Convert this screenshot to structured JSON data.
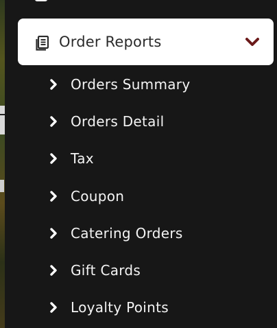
{
  "section": {
    "title": "Order Reports",
    "icon": "document-icon",
    "expand_icon": "chevron-down-icon",
    "accent_color": "#6b1a1a"
  },
  "menu": {
    "items": [
      {
        "label": "Orders Summary"
      },
      {
        "label": "Orders Detail"
      },
      {
        "label": "Tax"
      },
      {
        "label": "Coupon"
      },
      {
        "label": "Catering Orders"
      },
      {
        "label": "Gift Cards"
      },
      {
        "label": "Loyalty Points"
      }
    ]
  }
}
